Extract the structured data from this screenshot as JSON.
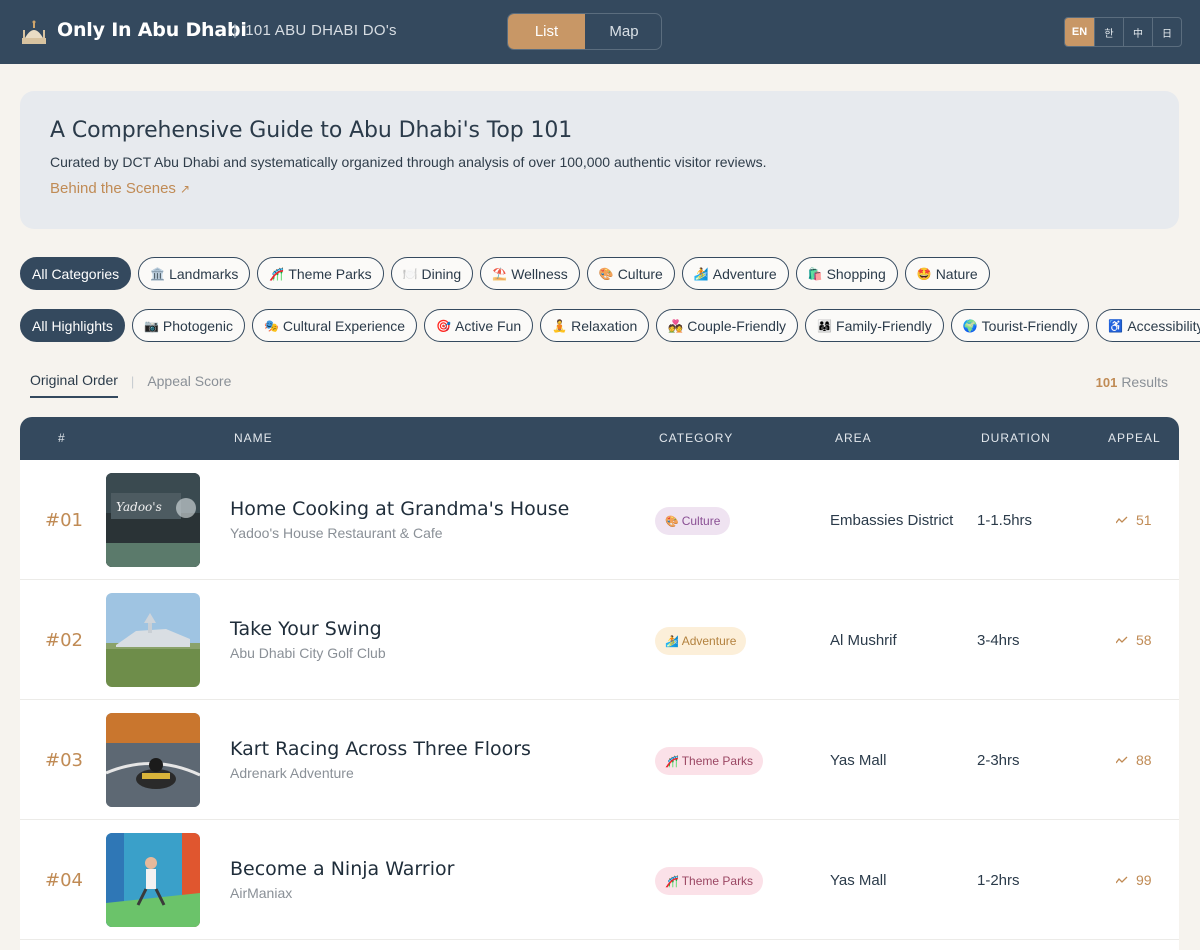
{
  "header": {
    "title": "Only In Abu Dhabi",
    "subtitle": "101 ABU DHABI DO's",
    "view_list": "List",
    "view_map": "Map",
    "languages": [
      "EN",
      "한",
      "中",
      "日"
    ]
  },
  "intro": {
    "heading": "A Comprehensive Guide to Abu Dhabi's Top 101",
    "description": "Curated by DCT Abu Dhabi and systematically organized through analysis of over 100,000 authentic visitor reviews.",
    "link": "Behind the Scenes"
  },
  "categories": [
    {
      "icon": "",
      "label": "All Categories"
    },
    {
      "icon": "🏛️",
      "label": "Landmarks"
    },
    {
      "icon": "🎢",
      "label": "Theme Parks"
    },
    {
      "icon": "🍽️",
      "label": "Dining"
    },
    {
      "icon": "⛱️",
      "label": "Wellness"
    },
    {
      "icon": "🎨",
      "label": "Culture"
    },
    {
      "icon": "🏄",
      "label": "Adventure"
    },
    {
      "icon": "🛍️",
      "label": "Shopping"
    },
    {
      "icon": "🤩",
      "label": "Nature"
    }
  ],
  "highlights": [
    {
      "icon": "",
      "label": "All Highlights"
    },
    {
      "icon": "📷",
      "label": "Photogenic"
    },
    {
      "icon": "🎭",
      "label": "Cultural Experience"
    },
    {
      "icon": "🎯",
      "label": "Active Fun"
    },
    {
      "icon": "🧘",
      "label": "Relaxation"
    },
    {
      "icon": "💑",
      "label": "Couple-Friendly"
    },
    {
      "icon": "👨‍👩‍👧",
      "label": "Family-Friendly"
    },
    {
      "icon": "🌍",
      "label": "Tourist-Friendly"
    },
    {
      "icon": "♿",
      "label": "Accessibility"
    }
  ],
  "sort": {
    "original": "Original Order",
    "appeal": "Appeal Score",
    "results_count": "101",
    "results_label": "Results"
  },
  "table": {
    "columns": [
      "#",
      "NAME",
      "CATEGORY",
      "AREA",
      "DURATION",
      "APPEAL"
    ],
    "rows": [
      {
        "rank": "#01",
        "name": "Home Cooking at Grandma's House",
        "venue": "Yadoo's House Restaurant & Cafe",
        "category_icon": "🎨",
        "category": "Culture",
        "area": "Embassies District",
        "duration": "1-1.5hrs",
        "appeal": "51"
      },
      {
        "rank": "#02",
        "name": "Take Your Swing",
        "venue": "Abu Dhabi City Golf Club",
        "category_icon": "🏄",
        "category": "Adventure",
        "area": "Al Mushrif",
        "duration": "3-4hrs",
        "appeal": "58"
      },
      {
        "rank": "#03",
        "name": "Kart Racing Across Three Floors",
        "venue": "Adrenark Adventure",
        "category_icon": "🎢",
        "category": "Theme Parks",
        "area": "Yas Mall",
        "duration": "2-3hrs",
        "appeal": "88"
      },
      {
        "rank": "#04",
        "name": "Become a Ninja Warrior",
        "venue": "AirManiax",
        "category_icon": "🎢",
        "category": "Theme Parks",
        "area": "Yas Mall",
        "duration": "1-2hrs",
        "appeal": "99"
      }
    ]
  },
  "colors": {
    "header_bg": "#34495e",
    "accent": "#c89766",
    "culture_badge_bg": "#efe3f1",
    "culture_badge_text": "#8a4f94",
    "adventure_badge_bg": "#fcefd9",
    "adventure_badge_text": "#b3823f",
    "themepark_badge_bg": "#fbe1e8",
    "themepark_badge_text": "#9b4763"
  }
}
